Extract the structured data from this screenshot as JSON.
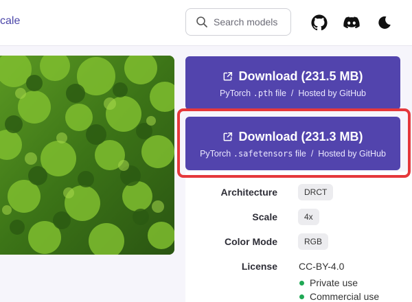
{
  "header": {
    "breadcrumb": "cale",
    "search": {
      "placeholder": "Search models",
      "value": ""
    },
    "icons": [
      "github-icon",
      "discord-icon",
      "moon-icon"
    ]
  },
  "downloads": [
    {
      "title": "Download (231.5 MB)",
      "format_prefix": "PyTorch ",
      "format_code": ".pth",
      "format_suffix": " file  /  Hosted by GitHub"
    },
    {
      "title": "Download (231.3 MB)",
      "format_prefix": "PyTorch ",
      "format_code": ".safetensors",
      "format_suffix": " file  /  Hosted by GitHub"
    }
  ],
  "properties": {
    "architecture": {
      "label": "Architecture",
      "value": "DRCT"
    },
    "scale": {
      "label": "Scale",
      "value": "4x"
    },
    "color_mode": {
      "label": "Color Mode",
      "value": "RGB"
    },
    "license": {
      "label": "License",
      "value": "CC-BY-4.0",
      "permissions": [
        "Private use",
        "Commercial use"
      ]
    }
  },
  "colors": {
    "button": "#5244ad",
    "highlight": "#e5383b",
    "permission_dot": "#20a855",
    "link": "#4a45a8"
  }
}
